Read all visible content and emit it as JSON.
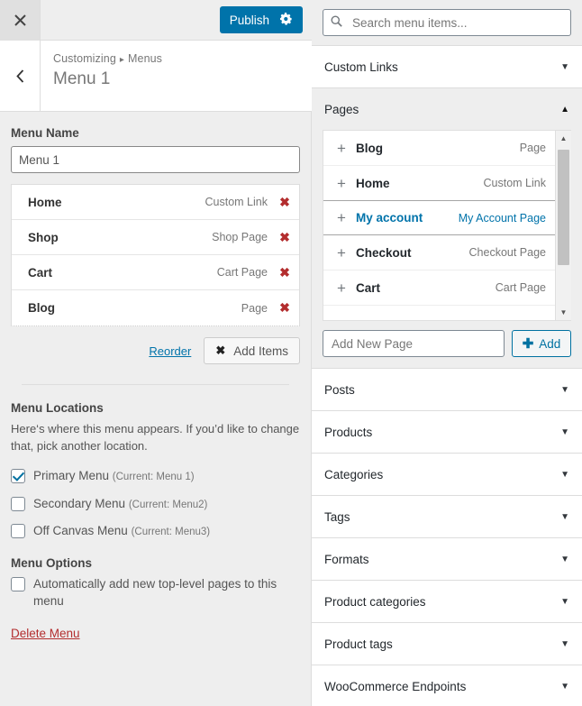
{
  "customizer": {
    "close_icon": "close-icon",
    "publish_label": "Publish",
    "gear_icon": "gear-icon",
    "back_icon": "chevron-left-icon",
    "breadcrumb_root": "Customizing",
    "breadcrumb_sep": "▸",
    "breadcrumb_current": "Menus",
    "panel_title": "Menu 1"
  },
  "menu_name": {
    "label": "Menu Name",
    "value": "Menu 1"
  },
  "menu_items": [
    {
      "title": "Home",
      "type": "Custom Link",
      "delete_icon": "✖"
    },
    {
      "title": "Shop",
      "type": "Shop Page",
      "delete_icon": "✖"
    },
    {
      "title": "Cart",
      "type": "Cart Page",
      "delete_icon": "✖"
    },
    {
      "title": "Blog",
      "type": "Page",
      "delete_icon": "✖"
    }
  ],
  "list_actions": {
    "reorder_label": "Reorder",
    "add_items_label": "Add Items",
    "add_items_icon": "✖"
  },
  "menu_locations": {
    "title": "Menu Locations",
    "description": "Here‘s where this menu appears. If you’d like to change that, pick another location.",
    "items": [
      {
        "label": "Primary Menu",
        "current": "(Current: Menu 1)",
        "checked": true
      },
      {
        "label": "Secondary Menu",
        "current": "(Current: Menu2)",
        "checked": false
      },
      {
        "label": "Off Canvas Menu",
        "current": "(Current: Menu3)",
        "checked": false
      }
    ]
  },
  "menu_options": {
    "title": "Menu Options",
    "auto_add_label": "Automatically add new top-level pages to this menu",
    "auto_add_checked": false,
    "delete_menu_label": "Delete Menu"
  },
  "available_items": {
    "search_placeholder": "Search menu items...",
    "search_value": "",
    "search_icon": "search-icon",
    "sections": [
      {
        "label": "Custom Links",
        "open": false,
        "arrow": "▼"
      },
      {
        "label": "Pages",
        "open": true,
        "arrow": "▲"
      },
      {
        "label": "Posts",
        "open": false,
        "arrow": "▼"
      },
      {
        "label": "Products",
        "open": false,
        "arrow": "▼"
      },
      {
        "label": "Categories",
        "open": false,
        "arrow": "▼"
      },
      {
        "label": "Tags",
        "open": false,
        "arrow": "▼"
      },
      {
        "label": "Formats",
        "open": false,
        "arrow": "▼"
      },
      {
        "label": "Product categories",
        "open": false,
        "arrow": "▼"
      },
      {
        "label": "Product tags",
        "open": false,
        "arrow": "▼"
      },
      {
        "label": "WooCommerce Endpoints",
        "open": false,
        "arrow": "▼"
      }
    ],
    "pages": [
      {
        "title": "Blog",
        "type": "Page",
        "active": false
      },
      {
        "title": "Home",
        "type": "Custom Link",
        "active": false
      },
      {
        "title": "My account",
        "type": "My Account Page",
        "active": true
      },
      {
        "title": "Checkout",
        "type": "Checkout Page",
        "active": false
      },
      {
        "title": "Cart",
        "type": "Cart Page",
        "active": false
      }
    ],
    "add_page": {
      "placeholder": "Add New Page",
      "value": "",
      "button_label": "Add",
      "button_icon": "✚"
    },
    "scroll_up_icon": "▲",
    "scroll_down_icon": "▼"
  },
  "colors": {
    "accent": "#0073aa",
    "danger": "#b32d2e",
    "panel_bg": "#eeeeee",
    "white": "#ffffff"
  }
}
